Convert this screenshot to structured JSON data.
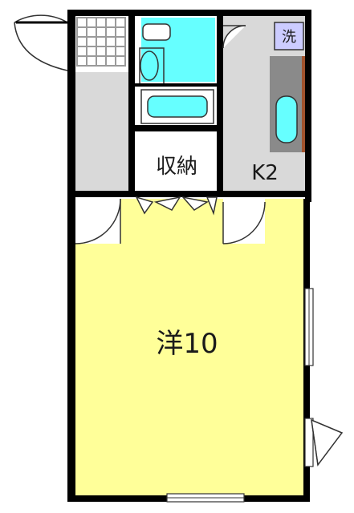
{
  "rooms": {
    "western_room": {
      "label": "洋10",
      "color": "#ffff99"
    },
    "storage": {
      "label": "収納",
      "color": "#ffffff"
    },
    "kitchen": {
      "label": "K2",
      "color": "#d9d9d9"
    },
    "bathroom": {
      "color": "#66ffff"
    },
    "corridor": {
      "color": "#d9d9d9"
    },
    "entrance": {
      "color": "#d9d9d9"
    }
  },
  "fixtures": {
    "washer_space": {
      "label": "洗",
      "color": "#ccccff"
    }
  },
  "colors": {
    "wall": "#000000",
    "fixture_fill": "#66ffff",
    "counter": "#8a8a8a",
    "accent_brown": "#a0522d"
  }
}
